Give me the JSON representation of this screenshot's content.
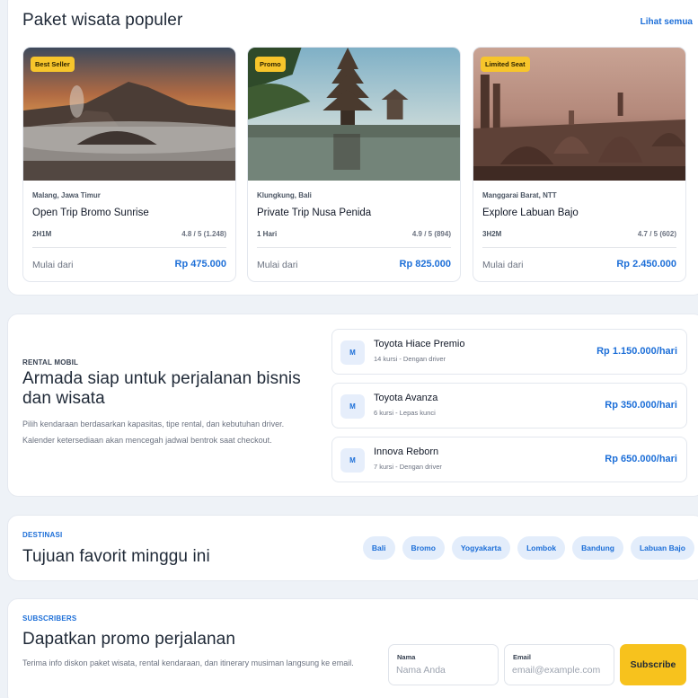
{
  "packages": {
    "title": "Paket wisata populer",
    "see_all": "Lihat semua",
    "from_label": "Mulai dari",
    "items": [
      {
        "badge": "Best Seller",
        "location": "Malang, Jawa Timur",
        "name": "Open Trip Bromo Sunrise",
        "duration": "2H1M",
        "rating": "4.8 / 5 (1.248)",
        "price": "Rp 475.000"
      },
      {
        "badge": "Promo",
        "location": "Klungkung, Bali",
        "name": "Private Trip Nusa Penida",
        "duration": "1 Hari",
        "rating": "4.9 / 5 (894)",
        "price": "Rp 825.000"
      },
      {
        "badge": "Limited Seat",
        "location": "Manggarai Barat, NTT",
        "name": "Explore Labuan Bajo",
        "duration": "3H2M",
        "rating": "4.7 / 5 (602)",
        "price": "Rp 2.450.000"
      }
    ]
  },
  "rental": {
    "eyebrow": "RENTAL MOBIL",
    "title": "Armada siap untuk perjalanan bisnis dan wisata",
    "description": "Pilih kendaraan berdasarkan kapasitas, tipe rental, dan kebutuhan driver. Kalender ketersediaan akan mencegah jadwal bentrok saat checkout.",
    "vehicles": [
      {
        "icon": "M",
        "name": "Toyota Hiace Premio",
        "meta": "14 kursi - Dengan driver",
        "price": "Rp 1.150.000/hari"
      },
      {
        "icon": "M",
        "name": "Toyota Avanza",
        "meta": "6 kursi - Lepas kunci",
        "price": "Rp 350.000/hari"
      },
      {
        "icon": "M",
        "name": "Innova Reborn",
        "meta": "7 kursi - Dengan driver",
        "price": "Rp 650.000/hari"
      }
    ]
  },
  "destinations": {
    "eyebrow": "DESTINASI",
    "title": "Tujuan favorit minggu ini",
    "chips": [
      "Bali",
      "Bromo",
      "Yogyakarta",
      "Lombok",
      "Bandung",
      "Labuan Bajo"
    ]
  },
  "subscribe": {
    "eyebrow": "SUBSCRIBERS",
    "title": "Dapatkan promo perjalanan",
    "description": "Terima info diskon paket wisata, rental kendaraan, dan itinerary musiman langsung ke email.",
    "name_label": "Nama",
    "name_placeholder": "Nama Anda",
    "email_label": "Email",
    "email_placeholder": "email@example.com",
    "button": "Subscribe"
  },
  "colors": {
    "accent": "#1d6fd8",
    "badge": "#f7c52b",
    "subscribe_button": "#f7c21d"
  }
}
